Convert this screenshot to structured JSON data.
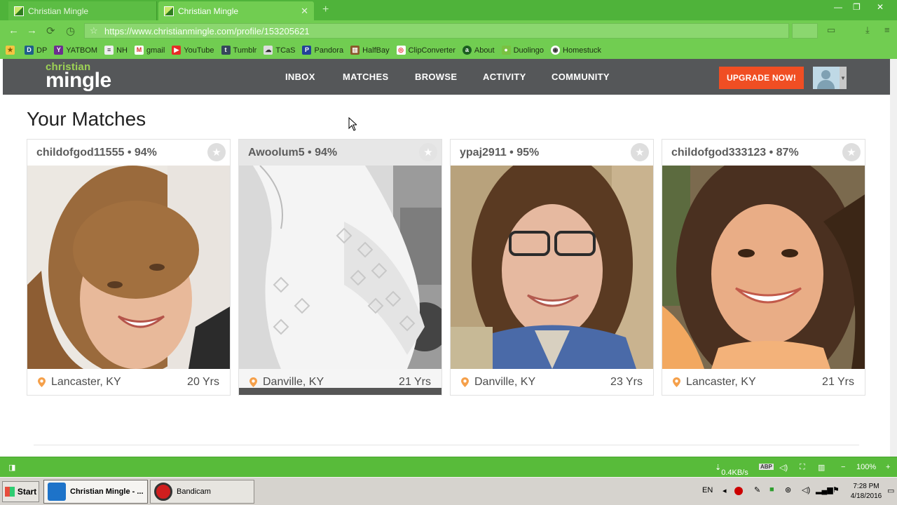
{
  "browser": {
    "tabs": [
      {
        "title": "Christian Mingle",
        "active": false
      },
      {
        "title": "Christian Mingle",
        "active": true
      }
    ],
    "url": "https://www.christianmingle.com/profile/153205621",
    "bookmarks": [
      "DP",
      "YATBOM",
      "NH",
      "gmail",
      "YouTube",
      "Tumblr",
      "TCaS",
      "Pandora",
      "HalfBay",
      "ClipConverter",
      "About",
      "Duolingo",
      "Homestuck"
    ],
    "status": {
      "speed": "0.4KB/s",
      "zoom": "100%"
    }
  },
  "site": {
    "logo_top": "christian",
    "logo_bottom": "mingle",
    "nav": [
      "INBOX",
      "MATCHES",
      "BROWSE",
      "ACTIVITY",
      "COMMUNITY"
    ],
    "upgrade_label": "UPGRADE NOW!"
  },
  "page": {
    "title": "Your Matches",
    "matches": [
      {
        "name": "childofgod11555 • 94%",
        "location": "Lancaster, KY",
        "age": "20 Yrs"
      },
      {
        "name": "Awoolum5 • 94%",
        "location": "Danville, KY",
        "age": "21 Yrs"
      },
      {
        "name": "ypaj2911 • 95%",
        "location": "Danville, KY",
        "age": "23 Yrs"
      },
      {
        "name": "childofgod333123 • 87%",
        "location": "Lancaster, KY",
        "age": "21 Yrs"
      }
    ]
  },
  "taskbar": {
    "start": "Start",
    "tasks": [
      "Christian Mingle - ...",
      "Bandicam"
    ],
    "lang": "EN",
    "time": "7:28 PM",
    "date": "4/18/2016"
  },
  "colors": {
    "brand_green": "#71cd51",
    "header_gray": "#555759",
    "upgrade_orange": "#f04e23"
  }
}
